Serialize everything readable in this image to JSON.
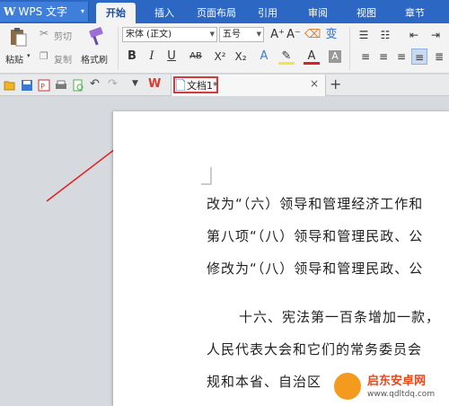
{
  "app": {
    "logo": "W",
    "name": "WPS 文字",
    "menu_caret": "▾"
  },
  "ribbon_tabs": [
    {
      "label": "开始",
      "active": true
    },
    {
      "label": "插入",
      "active": false
    },
    {
      "label": "页面布局",
      "active": false
    },
    {
      "label": "引用",
      "active": false
    },
    {
      "label": "审阅",
      "active": false
    },
    {
      "label": "视图",
      "active": false
    },
    {
      "label": "章节",
      "active": false
    }
  ],
  "clipboard": {
    "paste": "粘贴",
    "cut": "剪切",
    "copy": "复制",
    "format_painter": "格式刷"
  },
  "font": {
    "family": "宋体 (正文)",
    "size": "五号",
    "grow": "A⁺",
    "shrink": "A⁻"
  },
  "format": {
    "bold": "B",
    "italic": "I",
    "underline": "U",
    "abc": "AB",
    "superscript": "X²",
    "subscript": "X₂"
  },
  "document_tab": {
    "name": "文档1",
    "modified_marker": "*",
    "close": "×",
    "new_tab": "+"
  },
  "document": {
    "paragraphs": [
      "改为“（六）领导和管理经济工作和",
      "第八项“（八）领导和管理民政、公",
      "修改为“（八）领导和管理民政、公",
      "十六、宪法第一百条增加一款，",
      "人民代表大会和它们的常务委员会",
      "规和本省、自治区"
    ]
  },
  "watermark": {
    "title": "启东安卓网",
    "url": "www.qdltdq.com"
  },
  "colors": {
    "top_bar": "#2c67c4",
    "accent": "#d43a3a",
    "workspace": "#d6d9de"
  }
}
